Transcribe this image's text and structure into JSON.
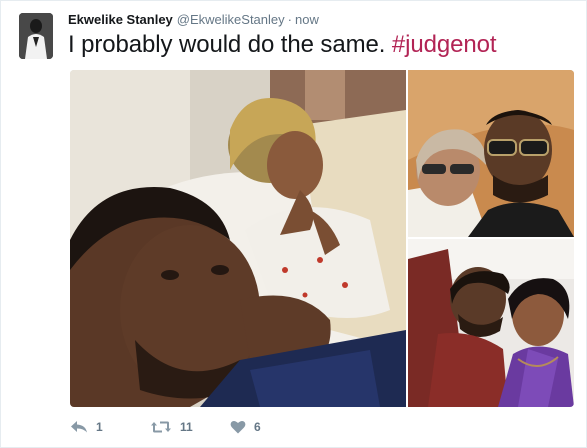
{
  "tweet": {
    "author_name": "Ekwelike Stanley",
    "handle": "@EkwelikeStanley",
    "separator": "·",
    "time": "now",
    "text": "I probably would do the same.",
    "hashtag": "#judgenot"
  },
  "actions": {
    "reply_icon": "reply-icon",
    "reply_count": "1",
    "retweet_icon": "retweet-icon",
    "retweet_count": "11",
    "like_icon": "heart-icon",
    "like_count": "6"
  },
  "colors": {
    "hashtag": "#b22455",
    "secondary_text": "#657786",
    "primary_text": "#14171a"
  }
}
